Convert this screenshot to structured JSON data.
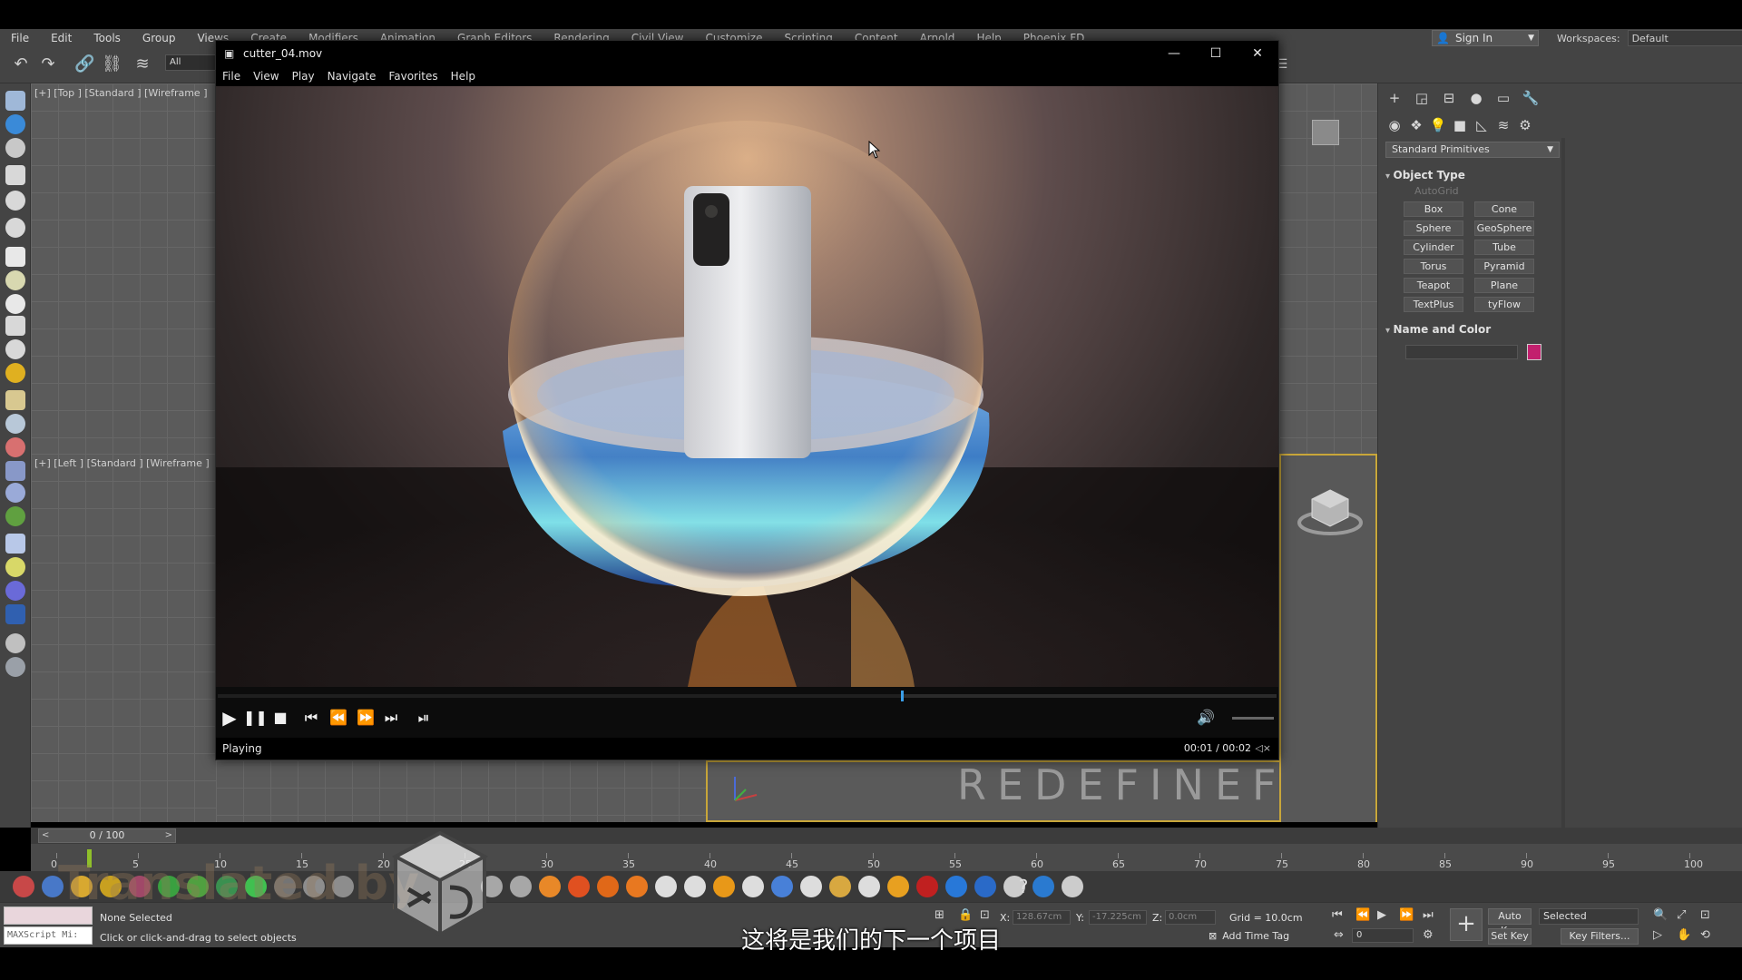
{
  "app_menu": [
    "File",
    "Edit",
    "Tools",
    "Group",
    "Views",
    "Create",
    "Modifiers",
    "Animation",
    "Graph Editors",
    "Rendering",
    "Civil View",
    "Customize",
    "Scripting",
    "Content",
    "Arnold",
    "Help",
    "Phoenix FD"
  ],
  "account": {
    "sign_in": "Sign In",
    "workspaces_label": "Workspaces:",
    "workspace": "Default"
  },
  "toolbar": {
    "selection_filter": "All"
  },
  "viewports": {
    "top_label": "[+] [Top ] [Standard ] [Wireframe ]",
    "left_label": "[+] [Left ] [Standard ] [Wireframe ]",
    "watermark": "REDEFINEFX.COM"
  },
  "command_panel": {
    "category": "Standard Primitives",
    "object_type_title": "Object Type",
    "autogrid": "AutoGrid",
    "objects": [
      "Box",
      "Cone",
      "Sphere",
      "GeoSphere",
      "Cylinder",
      "Tube",
      "Torus",
      "Pyramid",
      "Teapot",
      "Plane",
      "TextPlus",
      "tyFlow"
    ],
    "name_color_title": "Name and Color",
    "object_color": "#c2206e"
  },
  "timeline": {
    "frame_display": "0 / 100",
    "ticks": [
      0,
      5,
      10,
      15,
      20,
      25,
      30,
      35,
      40,
      45,
      50,
      55,
      60,
      65,
      70,
      75,
      80,
      85,
      90,
      95,
      100
    ]
  },
  "status_bar": {
    "maxscript": "MAXScript Mi:",
    "selection": "None Selected",
    "prompt": "Click or click-and-drag to select objects",
    "x_label": "X:",
    "x_value": "128.67cm",
    "y_label": "Y:",
    "y_value": "-17.225cm",
    "z_label": "Z:",
    "z_value": "0.0cm",
    "grid": "Grid = 10.0cm",
    "add_time_tag": "Add Time Tag",
    "frame": "0",
    "auto_key": "Auto Key",
    "set_key": "Set Key",
    "key_mode": "Selected",
    "key_filters": "Key Filters..."
  },
  "player": {
    "title": "cutter_04.mov",
    "menu": [
      "File",
      "View",
      "Play",
      "Navigate",
      "Favorites",
      "Help"
    ],
    "state": "Playing",
    "time": "00:01 / 00:02",
    "progress": 0.645
  },
  "overlay": {
    "subtitle": "这将是我们的下一个项目",
    "translated_watermark": "Translated by"
  }
}
